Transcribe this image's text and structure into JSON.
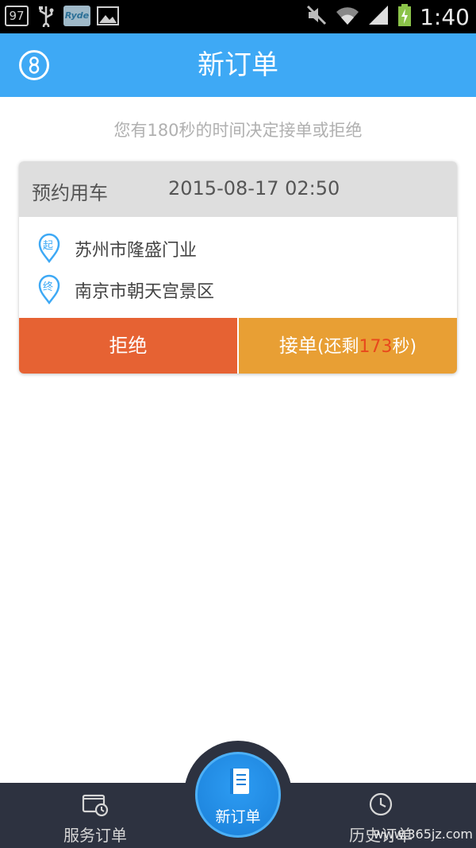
{
  "status_bar": {
    "notification_badge": "97",
    "app_icon_text": "Ryde",
    "time": "1:40"
  },
  "header": {
    "title": "新订单",
    "profile_icon": "user-circle-icon"
  },
  "hint": "您有180秒的时间决定接单或拒绝",
  "order": {
    "type": "预约用车",
    "time": "2015-08-17 02:50",
    "start_marker": "起",
    "start": "苏州市隆盛门业",
    "end_marker": "终",
    "end": "南京市朝天宫景区",
    "reject_label": "拒绝",
    "accept_label": "接单",
    "accept_prefix": "(还剩",
    "accept_seconds": "173",
    "accept_suffix": "秒)"
  },
  "bottom_nav": {
    "left_label": "服务订单",
    "center_label": "新订单",
    "right_label": "历史订单"
  },
  "watermark": "www.365jz.com",
  "colors": {
    "brand": "#3ea9f5",
    "reject": "#e66233",
    "accept": "#e89f34",
    "nav_bg": "#2d3240"
  }
}
